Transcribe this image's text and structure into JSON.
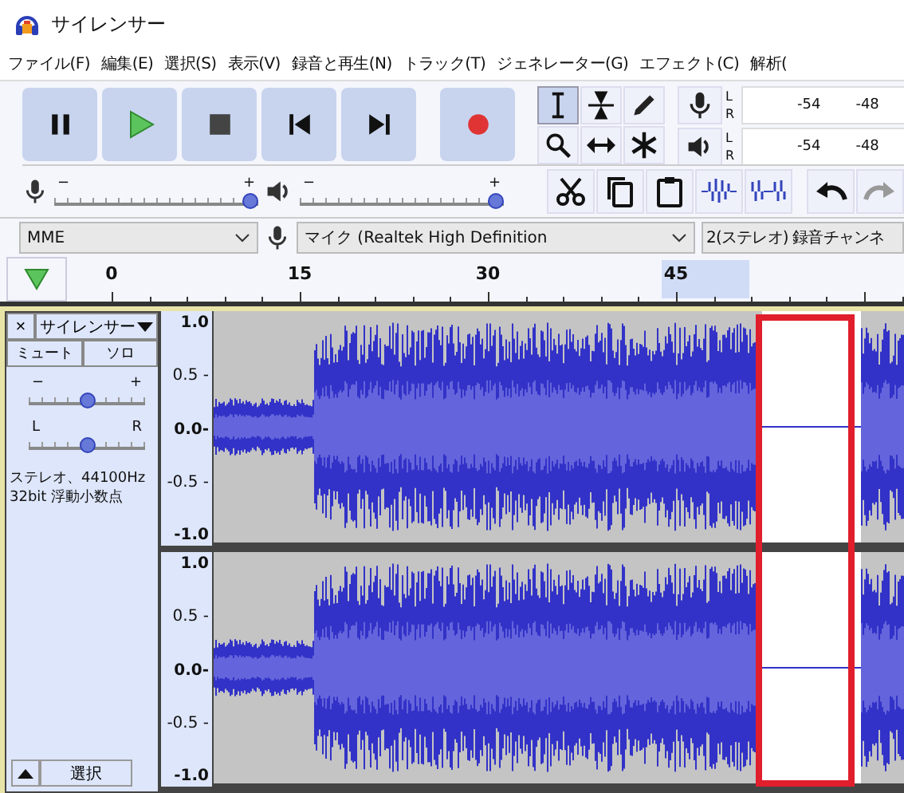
{
  "window": {
    "title": "サイレンサー"
  },
  "menu": [
    "ファイル(F)",
    "編集(E)",
    "選択(S)",
    "表示(V)",
    "録音と再生(N)",
    "トラック(T)",
    "ジェネレーター(G)",
    "エフェクト(C)",
    "解析("
  ],
  "tools": [
    {
      "kind": "ibeam",
      "selected": true
    },
    {
      "kind": "envelope",
      "selected": false
    },
    {
      "kind": "pencil",
      "selected": false
    },
    {
      "kind": "zoom",
      "selected": false
    },
    {
      "kind": "timeshift",
      "selected": false
    },
    {
      "kind": "multi",
      "selected": false
    }
  ],
  "meters": [
    {
      "kind": "record",
      "channels": [
        "L",
        "R"
      ],
      "ticks": [
        "-54",
        "-48"
      ]
    },
    {
      "kind": "play",
      "channels": [
        "L",
        "R"
      ],
      "ticks": [
        "-54",
        "-48"
      ]
    }
  ],
  "mixer": [
    {
      "kind": "record",
      "minus": "−",
      "plus": "+",
      "level": 1.0
    },
    {
      "kind": "play",
      "minus": "−",
      "plus": "+",
      "level": 1.0
    }
  ],
  "devices": {
    "host": "MME",
    "input": "マイク (Realtek High Definition",
    "channels": "2(ステレオ) 録音チャンネ"
  },
  "ruler": {
    "labels": [
      "0",
      "15",
      "30",
      "45"
    ]
  },
  "track": {
    "close": "×",
    "name": "サイレンサー",
    "mute": "ミュート",
    "solo": "ソロ",
    "gain": {
      "minus": "−",
      "plus": "+",
      "level": 0.5
    },
    "pan": {
      "left": "L",
      "right": "R",
      "level": 0.5
    },
    "info": [
      "ステレオ、44100Hz",
      "32bit 浮動小数点"
    ],
    "select": "選択",
    "channels": [
      {
        "scale": [
          "1.0",
          "0.5 -",
          "0.0-",
          "-0.5 -",
          "-1.0"
        ]
      },
      {
        "scale": [
          "1.0",
          "0.5 -",
          "0.0-",
          "-0.5 -",
          "-1.0"
        ]
      }
    ]
  }
}
